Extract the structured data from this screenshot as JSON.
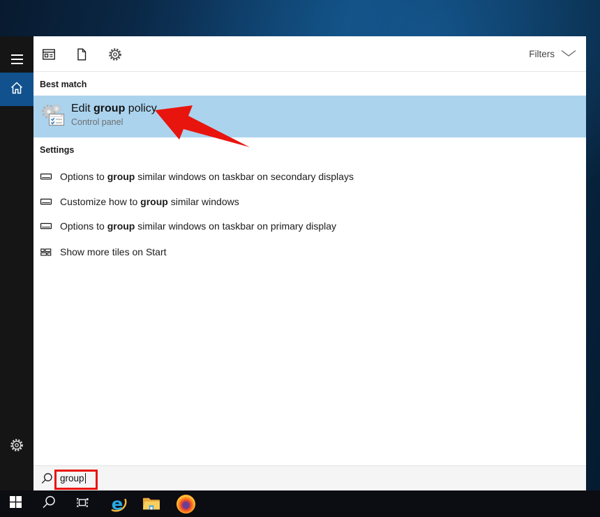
{
  "colors": {
    "accent_blue": "#11518e",
    "highlight_blue": "#abd3ee",
    "annotation_red": "#e8150e",
    "sidebar_bg": "#151515",
    "taskbar_bg": "#0c0c13",
    "panel_bg": "#ffffff"
  },
  "sidebar": {
    "menu_icon": "hamburger-icon",
    "home_icon": "home-icon",
    "settings_icon": "gear-icon"
  },
  "search_panel": {
    "header": {
      "filter_icons": [
        "apps-filter-icon",
        "documents-filter-icon",
        "settings-filter-icon"
      ],
      "filters_label": "Filters"
    },
    "best_match": {
      "section_label": "Best match",
      "result": {
        "icon": "group-policy-editor-icon",
        "title_prefix": "Edit ",
        "title_bold": "group",
        "title_suffix": " policy",
        "subtitle": "Control panel"
      }
    },
    "settings_section": {
      "section_label": "Settings",
      "items": [
        {
          "icon": "taskbar-setting-icon",
          "prefix": "Options to ",
          "bold": "group",
          "suffix": " similar windows on taskbar on secondary displays"
        },
        {
          "icon": "taskbar-setting-icon",
          "prefix": "Customize how to ",
          "bold": "group",
          "suffix": " similar windows"
        },
        {
          "icon": "taskbar-setting-icon",
          "prefix": "Options to ",
          "bold": "group",
          "suffix": " similar windows on taskbar on primary display"
        },
        {
          "icon": "tiles-setting-icon",
          "prefix": "Show more tiles on Start",
          "bold": "",
          "suffix": ""
        }
      ]
    },
    "search_box": {
      "icon": "search-icon",
      "value": "group"
    }
  },
  "taskbar": {
    "items": [
      "start-button",
      "search-button",
      "task-view-button",
      "internet-explorer-icon",
      "file-explorer-icon",
      "firefox-icon"
    ]
  }
}
